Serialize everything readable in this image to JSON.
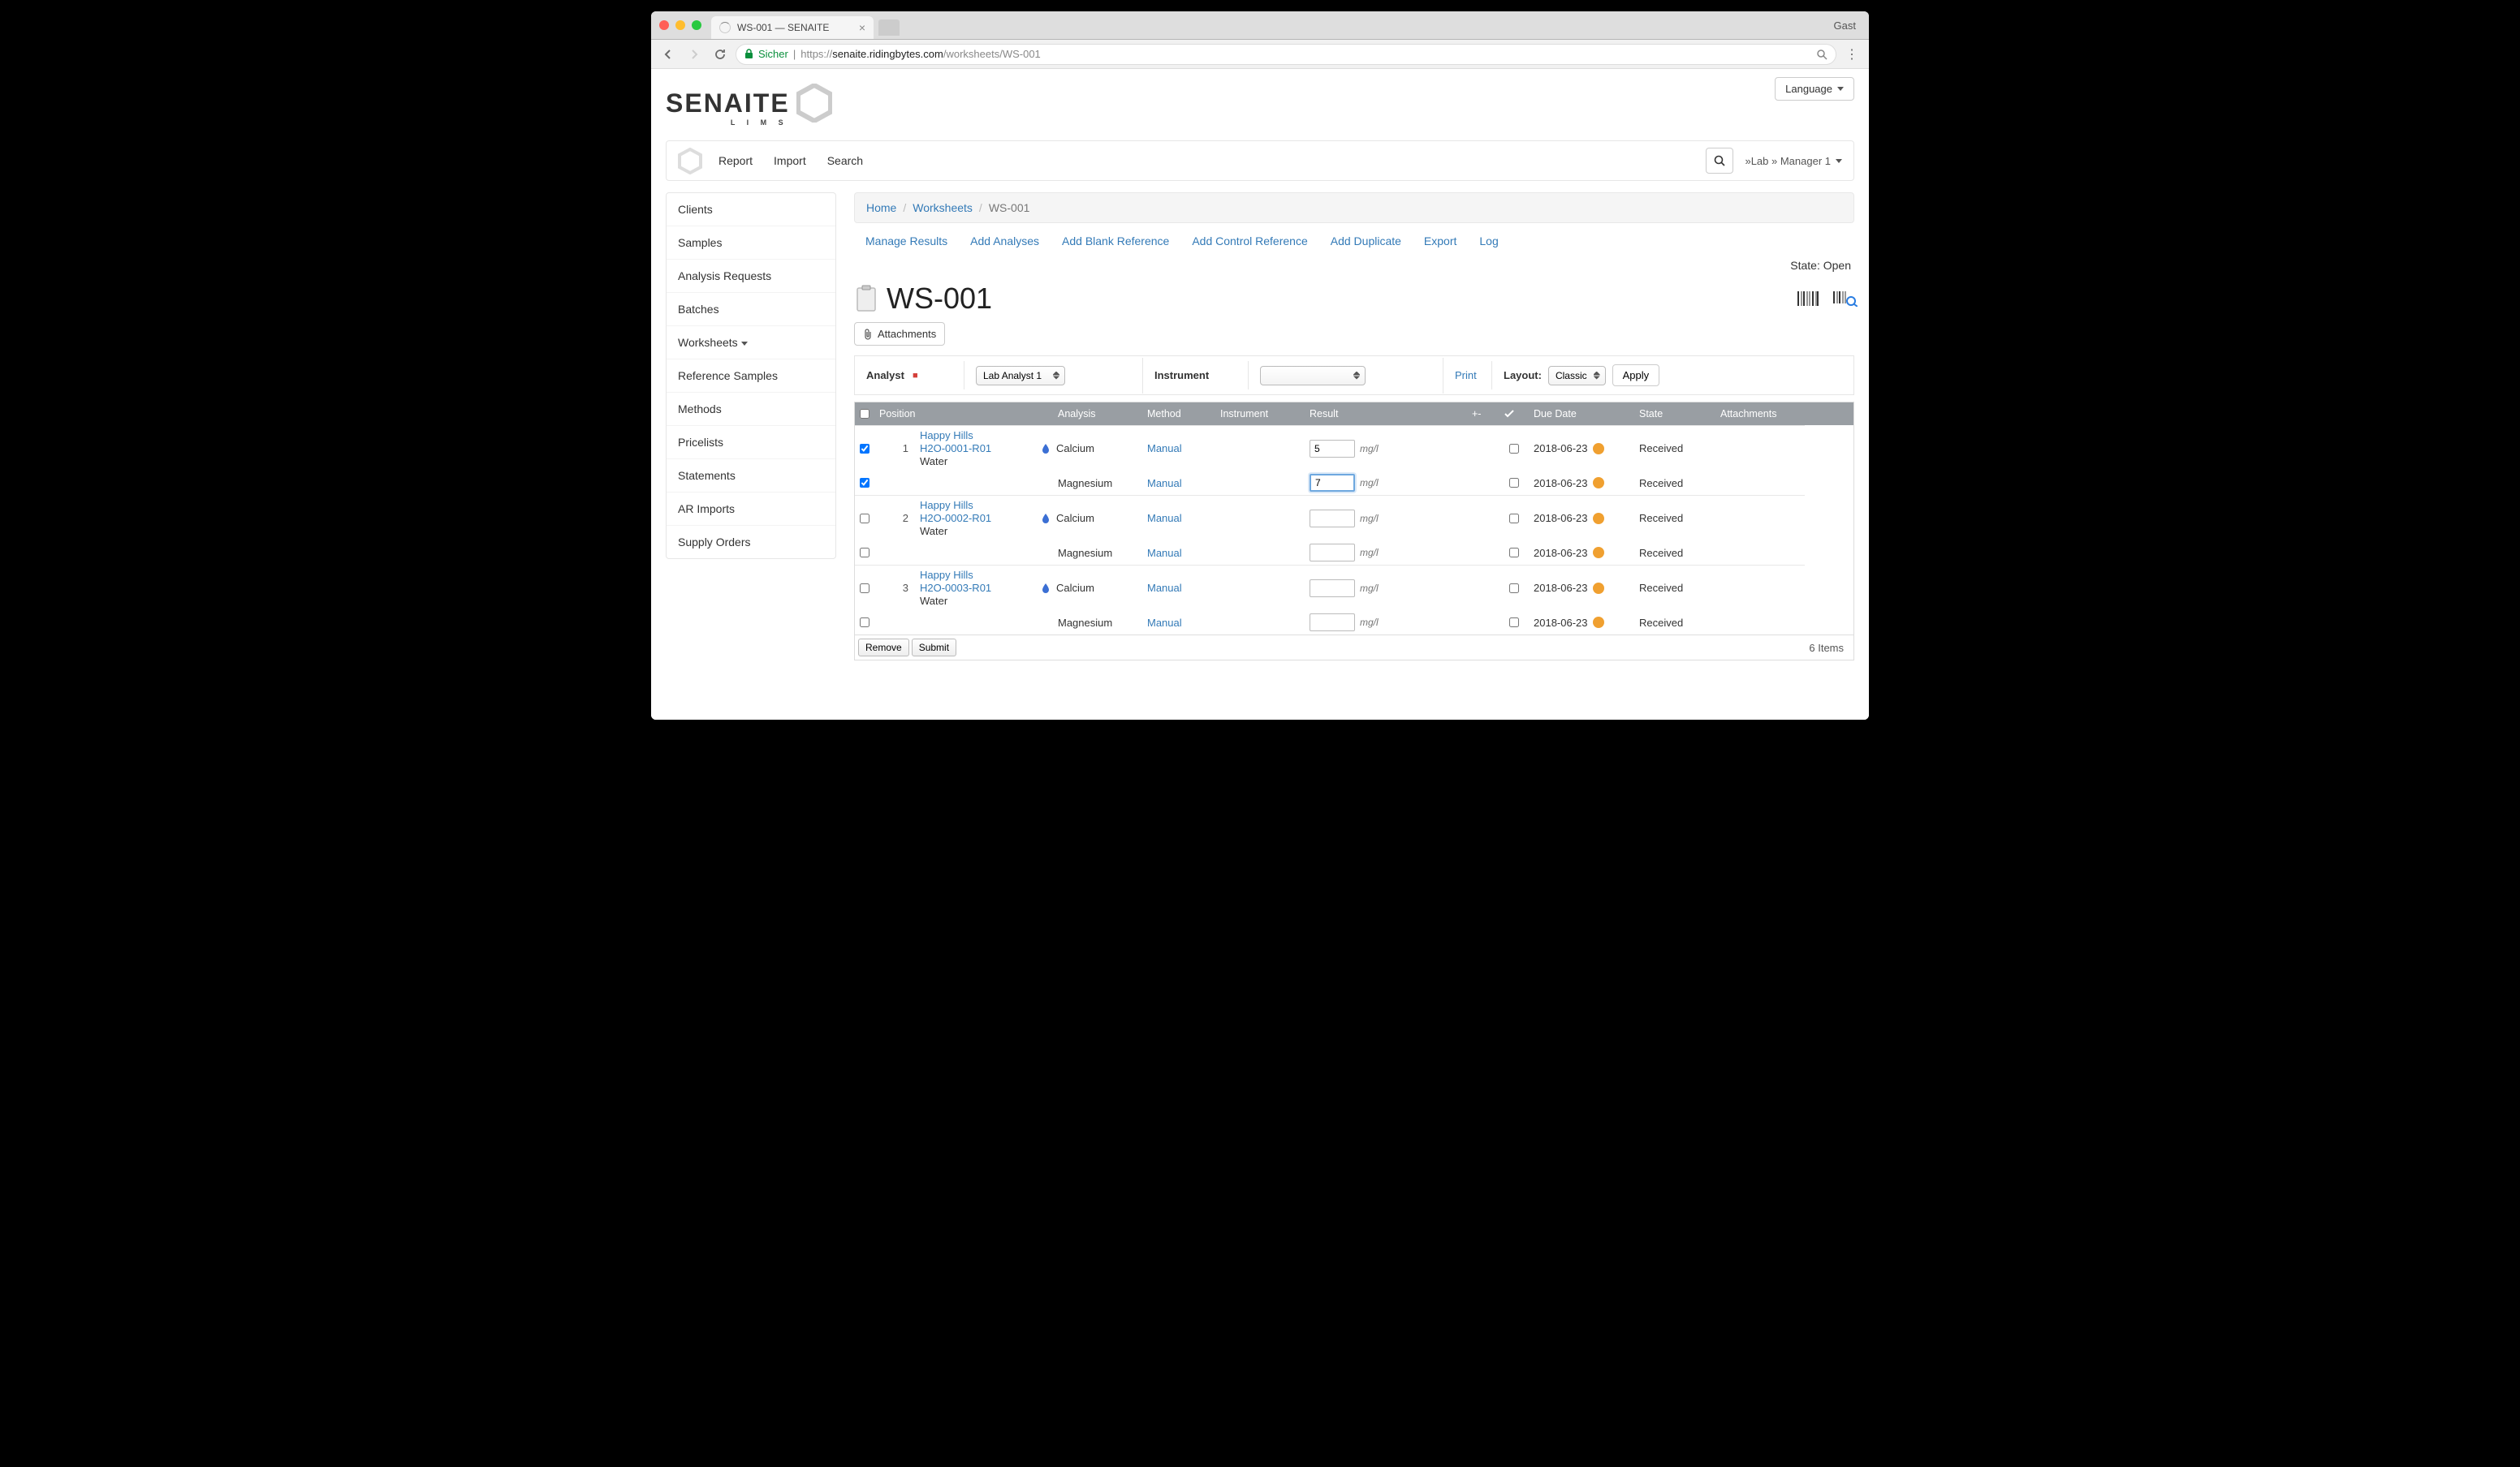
{
  "browser": {
    "tab_title": "WS-001 — SENAITE",
    "user": "Gast",
    "secure_label": "Sicher",
    "url_prefix": "https://",
    "url_domain": "senaite.ridingbytes.com",
    "url_path": "/worksheets/WS-001"
  },
  "header": {
    "logo_main": "SENAITE",
    "logo_sub": "L I M S",
    "language_label": "Language"
  },
  "topnav": {
    "items": [
      "Report",
      "Import",
      "Search"
    ],
    "user": "»Lab » Manager 1"
  },
  "sidebar": {
    "items": [
      {
        "label": "Clients"
      },
      {
        "label": "Samples"
      },
      {
        "label": "Analysis Requests"
      },
      {
        "label": "Batches"
      },
      {
        "label": "Worksheets",
        "submenu": true
      },
      {
        "label": "Reference Samples"
      },
      {
        "label": "Methods"
      },
      {
        "label": "Pricelists"
      },
      {
        "label": "Statements"
      },
      {
        "label": "AR Imports"
      },
      {
        "label": "Supply Orders"
      }
    ]
  },
  "breadcrumb": {
    "items": [
      {
        "label": "Home",
        "link": true
      },
      {
        "label": "Worksheets",
        "link": true
      },
      {
        "label": "WS-001",
        "link": false
      }
    ]
  },
  "tabs": {
    "items": [
      "Manage Results",
      "Add Analyses",
      "Add Blank Reference",
      "Add Control Reference",
      "Add Duplicate",
      "Export",
      "Log"
    ]
  },
  "page": {
    "state_label": "State: ",
    "state_value": "Open",
    "title": "WS-001",
    "attachments_label": "Attachments"
  },
  "filter": {
    "analyst_label": "Analyst",
    "analyst_value": "Lab Analyst 1",
    "instrument_label": "Instrument",
    "instrument_value": "",
    "print_label": "Print",
    "layout_label": "Layout:",
    "layout_value": "Classic",
    "apply_label": "Apply"
  },
  "grid": {
    "headers": {
      "position": "Position",
      "analysis": "Analysis",
      "method": "Method",
      "instrument": "Instrument",
      "result": "Result",
      "range": "+-",
      "check": "✓",
      "due": "Due Date",
      "state": "State",
      "attachments": "Attachments"
    },
    "samples": [
      {
        "position": "1",
        "client": "Happy Hills",
        "ref": "H2O-0001-R01",
        "type": "Water",
        "analyses": [
          {
            "name": "Calcium",
            "method": "Manual",
            "result": "5",
            "unit": "mg/l",
            "checked": true,
            "due": "2018-06-23",
            "state": "Received",
            "active": false
          },
          {
            "name": "Magnesium",
            "method": "Manual",
            "result": "7",
            "unit": "mg/l",
            "checked": true,
            "due": "2018-06-23",
            "state": "Received",
            "active": true
          }
        ]
      },
      {
        "position": "2",
        "client": "Happy Hills",
        "ref": "H2O-0002-R01",
        "type": "Water",
        "analyses": [
          {
            "name": "Calcium",
            "method": "Manual",
            "result": "",
            "unit": "mg/l",
            "checked": false,
            "due": "2018-06-23",
            "state": "Received"
          },
          {
            "name": "Magnesium",
            "method": "Manual",
            "result": "",
            "unit": "mg/l",
            "checked": false,
            "due": "2018-06-23",
            "state": "Received"
          }
        ]
      },
      {
        "position": "3",
        "client": "Happy Hills",
        "ref": "H2O-0003-R01",
        "type": "Water",
        "analyses": [
          {
            "name": "Calcium",
            "method": "Manual",
            "result": "",
            "unit": "mg/l",
            "checked": false,
            "due": "2018-06-23",
            "state": "Received"
          },
          {
            "name": "Magnesium",
            "method": "Manual",
            "result": "",
            "unit": "mg/l",
            "checked": false,
            "due": "2018-06-23",
            "state": "Received"
          }
        ]
      }
    ],
    "remove_label": "Remove",
    "submit_label": "Submit",
    "items_count": "6 Items"
  }
}
